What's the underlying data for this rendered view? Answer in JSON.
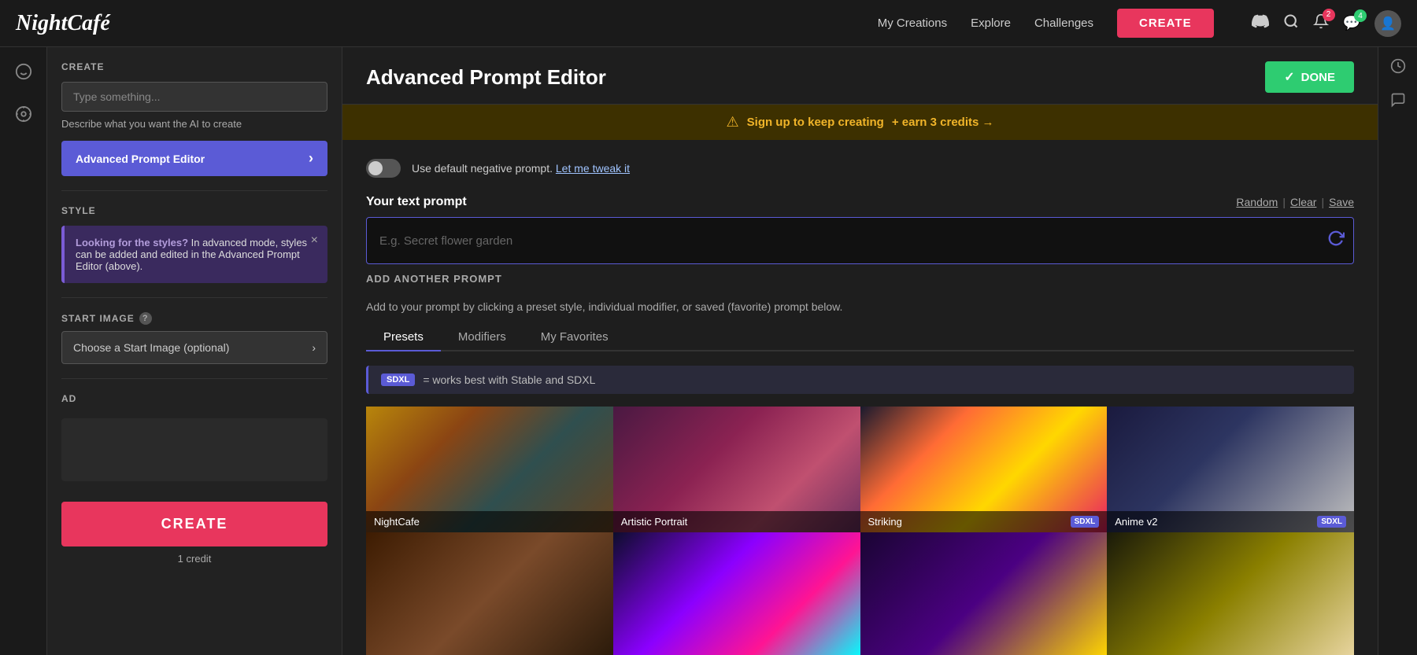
{
  "topnav": {
    "logo": "NightCafé",
    "links": [
      "My Creations",
      "Explore",
      "Challenges"
    ],
    "create_label": "CREATE",
    "notifications_count": "2",
    "messages_count": "4"
  },
  "sidebar": {
    "section_create": "CREATE",
    "input_placeholder": "Type something...",
    "input_desc": "Describe what you want the AI to create",
    "advanced_btn_label": "Advanced Prompt Editor",
    "style_section": "STYLE",
    "style_notice_bold": "Looking for the styles?",
    "style_notice_text": " In advanced mode, styles can be added and edited in the Advanced Prompt Editor (above).",
    "start_image_section": "START IMAGE",
    "start_image_btn": "Choose a Start Image (optional)",
    "ad_section": "AD",
    "create_btn": "CREATE",
    "credit_info": "1 credit"
  },
  "content": {
    "title": "Advanced Prompt Editor",
    "done_btn": "DONE",
    "banner_warn": "⚠",
    "banner_text": "Sign up to keep creating",
    "banner_link": "+ earn 3 credits →",
    "neg_prompt_text": "Use default negative prompt.",
    "neg_prompt_link": "Let me tweak it",
    "your_text_prompt": "Your text prompt",
    "prompt_placeholder": "E.g. Secret flower garden",
    "random_label": "Random",
    "clear_label": "Clear",
    "save_label": "Save",
    "add_prompt_btn": "ADD ANOTHER PROMPT",
    "preset_info": "Add to your prompt by clicking a preset style, individual modifier, or saved (favorite) prompt below.",
    "tabs": [
      "Presets",
      "Modifiers",
      "My Favorites"
    ],
    "sdxl_text": "= works best with Stable and SDXL",
    "image_cards": [
      {
        "label": "NightCafe",
        "sdxl": false,
        "img_class": "img-nightcafe"
      },
      {
        "label": "Artistic Portrait",
        "sdxl": false,
        "img_class": "img-artistic"
      },
      {
        "label": "Striking",
        "sdxl": true,
        "img_class": "img-striking"
      },
      {
        "label": "Anime v2",
        "sdxl": true,
        "img_class": "img-anime"
      },
      {
        "label": "",
        "sdxl": false,
        "img_class": "img-extra1"
      },
      {
        "label": "",
        "sdxl": false,
        "img_class": "img-extra2"
      },
      {
        "label": "",
        "sdxl": false,
        "img_class": "img-extra3"
      },
      {
        "label": "",
        "sdxl": false,
        "img_class": "img-extra4"
      }
    ]
  }
}
